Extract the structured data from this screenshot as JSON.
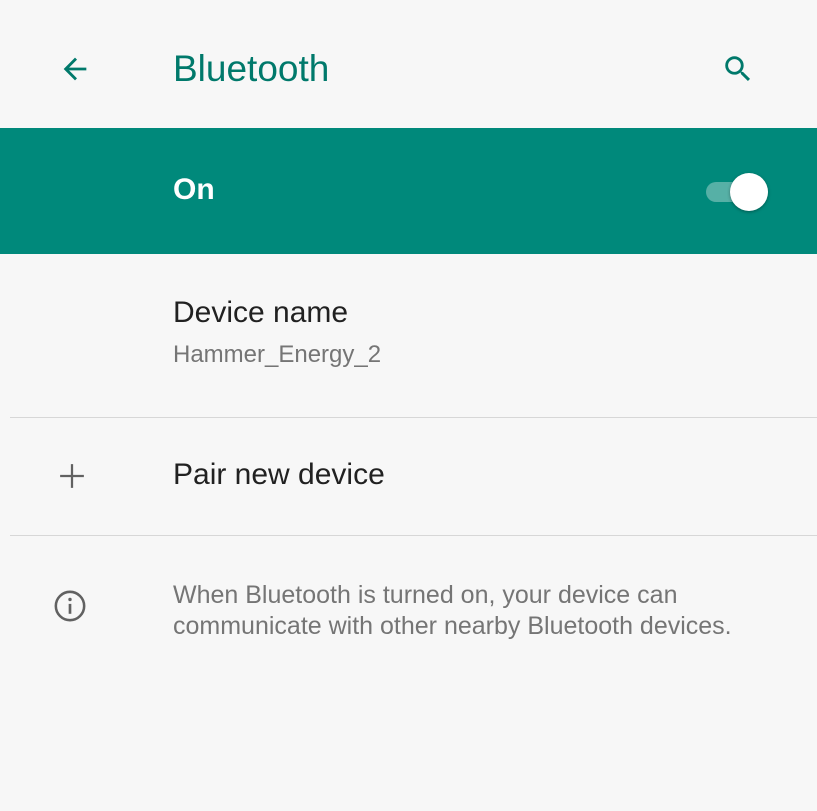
{
  "toolbar": {
    "back_icon": "arrow-back-icon",
    "title": "Bluetooth",
    "search_icon": "search-icon"
  },
  "master_switch": {
    "label": "On",
    "checked": true
  },
  "device_name": {
    "title": "Device name",
    "summary": "Hammer_Energy_2"
  },
  "pair_new_device": {
    "icon": "plus-icon",
    "title": "Pair new device"
  },
  "footer": {
    "icon": "info-icon",
    "text": "When Bluetooth is turned on, your device can communicate with other nearby Bluetooth devices."
  },
  "colors": {
    "accent": "#00796b",
    "switch_bar": "#00897b",
    "switch_track": "#56b0a6",
    "background": "#f7f7f7",
    "secondary_text": "#757575",
    "icon": "#616161"
  }
}
